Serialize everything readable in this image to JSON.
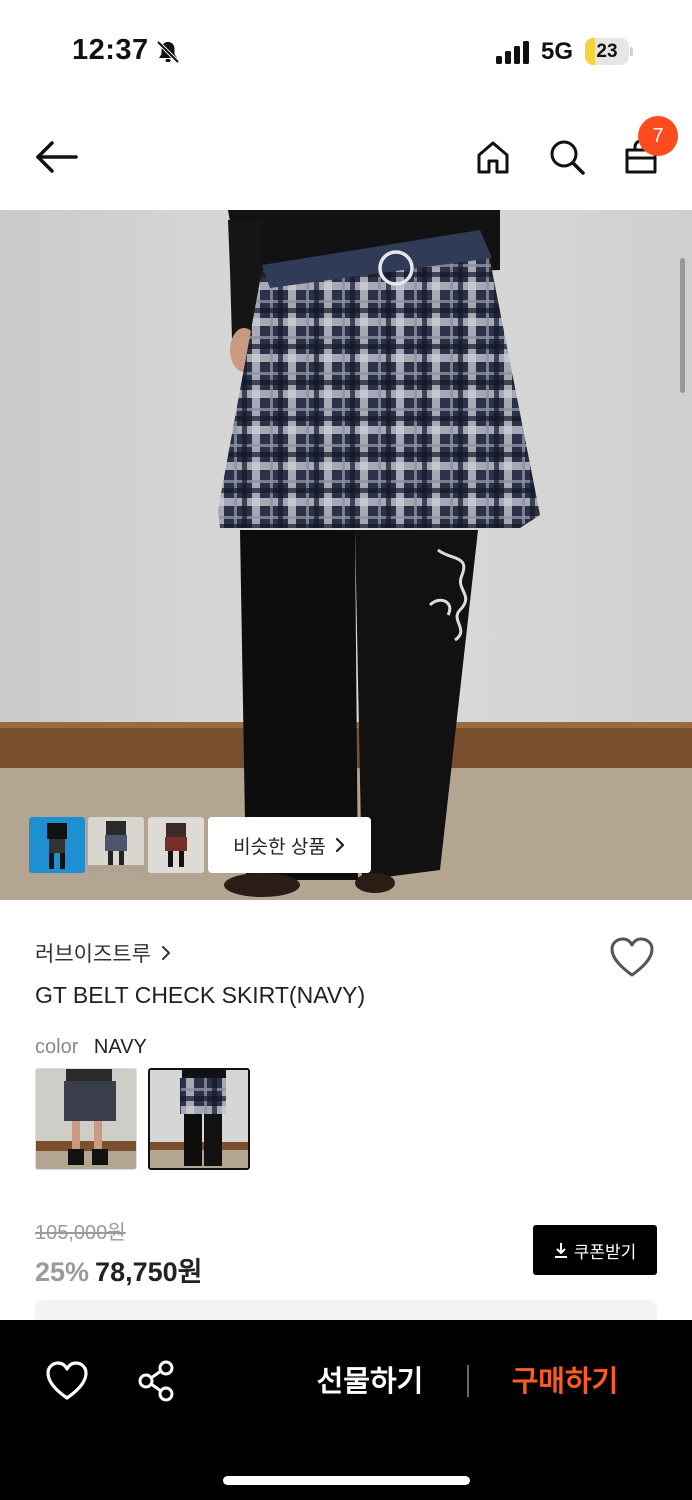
{
  "status_bar": {
    "time": "12:37",
    "network": "5G",
    "battery": "23",
    "battery_level": 0.23,
    "icons": [
      "bell-slash-icon",
      "signal-icon",
      "battery-icon"
    ]
  },
  "nav": {
    "cart_count": "7",
    "icons": [
      "back-arrow-icon",
      "home-icon",
      "search-icon",
      "shopping-bag-icon"
    ]
  },
  "gallery": {
    "similar_button_label": "비슷한 상품",
    "thumbnail_count": 3
  },
  "product": {
    "brand": "러브이즈트루",
    "title": "GT BELT CHECK SKIRT(NAVY)",
    "option_label": "color",
    "option_value": "NAVY",
    "original_price": "105,000원",
    "discount": "25%",
    "sale_price": "78,750원",
    "coupon_label": "쿠폰받기"
  },
  "bottom_bar": {
    "gift_label": "선물하기",
    "buy_label": "구매하기"
  },
  "colors": {
    "accent": "#ff4b1f",
    "buy_text": "#ff5a1f",
    "bottom_bar_bg": "#000000"
  }
}
